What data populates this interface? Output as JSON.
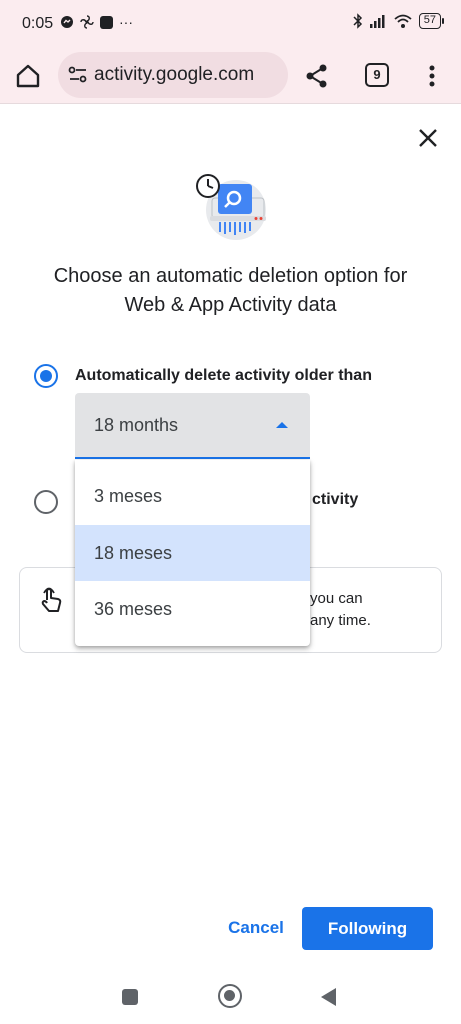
{
  "status_bar": {
    "time": "0:05",
    "overflow_indicator": "···",
    "battery": "57"
  },
  "browser": {
    "url": "activity.google.com",
    "tab_count": "9"
  },
  "dialog": {
    "title": "Choose an automatic deletion option for Web & App Activity data",
    "option_auto_delete_label": "Automatically delete activity older than",
    "option_keep_label_visible": "ctivity",
    "select_value": "18 months",
    "dropdown_options": [
      "3 meses",
      "18 meses",
      "36 meses"
    ],
    "selected_option_index": 1,
    "info_text_line1": "you can",
    "info_text_line2": "any time.",
    "cancel_label": "Cancel",
    "primary_label": "Following"
  },
  "colors": {
    "accent": "#1a73e8",
    "browser_chrome": "#fbecef",
    "selected_item_bg": "#d3e3fd"
  },
  "icons": [
    "home-icon",
    "site-settings-icon",
    "share-icon",
    "overflow-menu-icon",
    "close-icon",
    "activity-controls-illustration",
    "touch-icon",
    "bluetooth-icon",
    "signal-icon",
    "wifi-icon",
    "battery-icon"
  ]
}
